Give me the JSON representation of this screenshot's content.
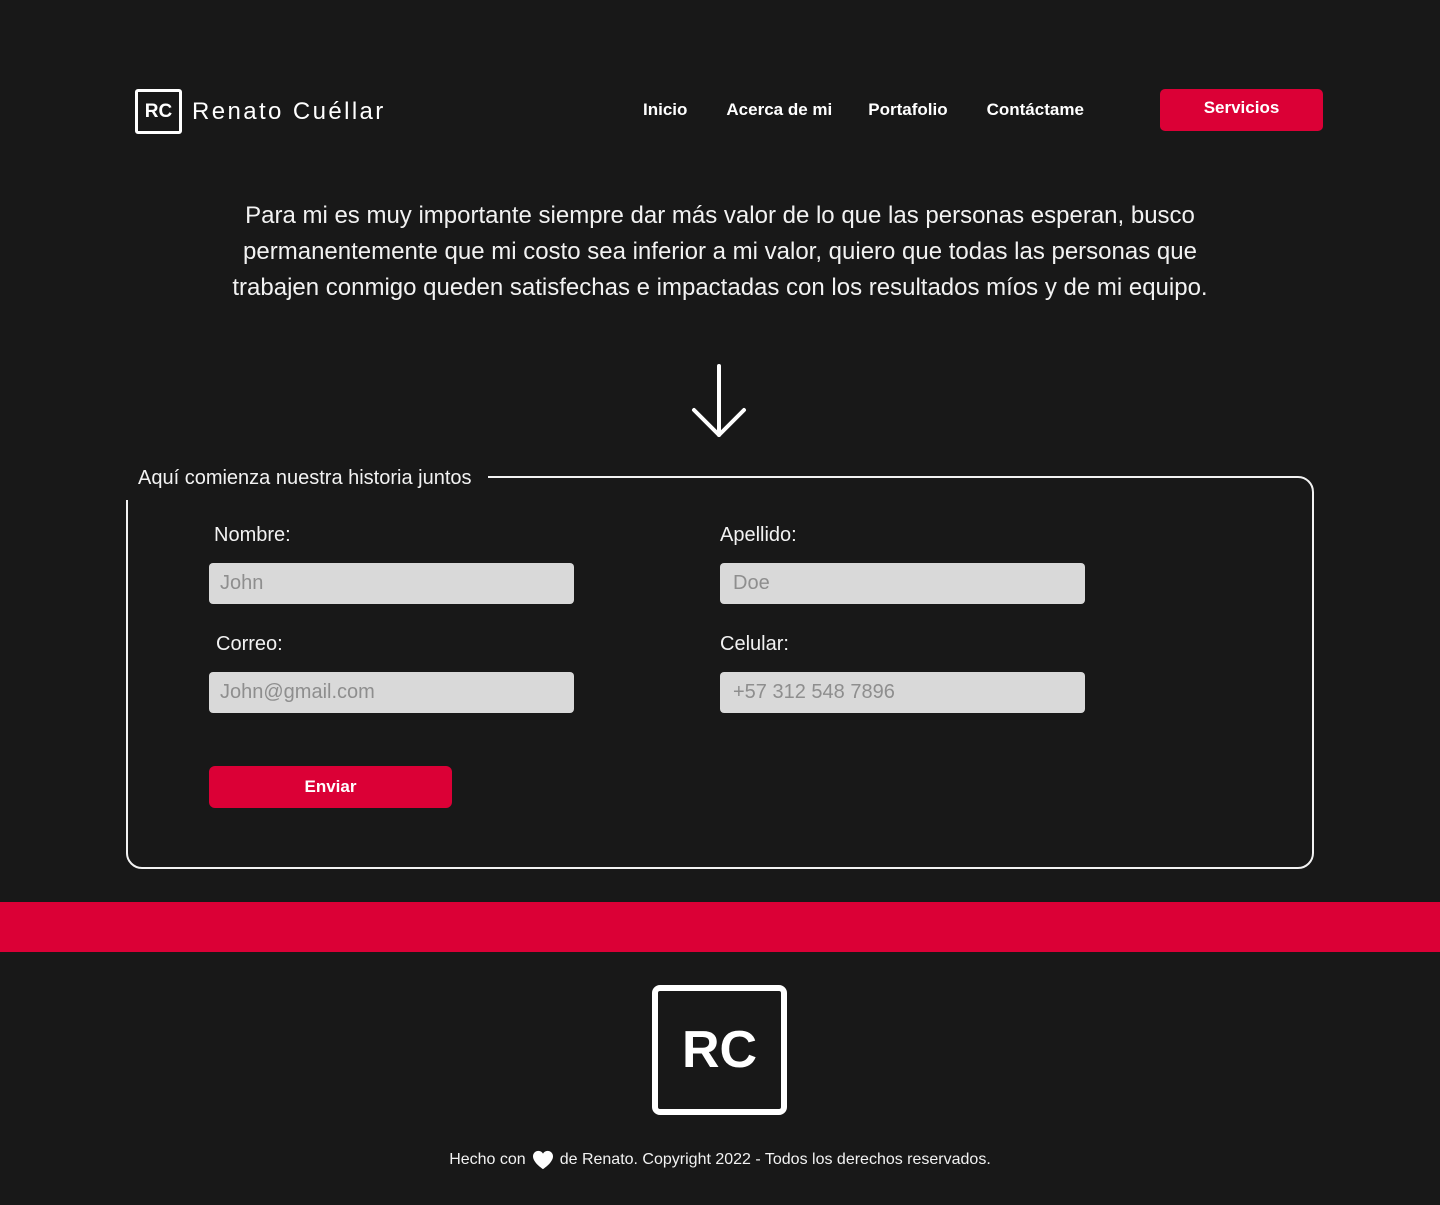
{
  "header": {
    "logo_initials": "RC",
    "logo_name": "Renato Cuéllar",
    "nav": [
      "Inicio",
      "Acerca de mi",
      "Portafolio",
      "Contáctame"
    ],
    "cta_label": "Servicios"
  },
  "intro": {
    "text": "Para mi es muy importante siempre dar más valor de lo que las personas esperan, busco permanentemente que mi costo sea inferior a mi valor, quiero que todas las personas que trabajen conmigo queden satisfechas e impactadas con los resultados míos y de mi equipo."
  },
  "form": {
    "legend": "Aquí comienza nuestra historia juntos",
    "fields": [
      {
        "label": "Nombre:",
        "placeholder": "John",
        "value": ""
      },
      {
        "label": "Apellido:",
        "placeholder": "Doe",
        "value": ""
      },
      {
        "label": "Correo:",
        "placeholder": "John@gmail.com",
        "value": ""
      },
      {
        "label": "Celular:",
        "placeholder": "+57 312 548 7896",
        "value": ""
      }
    ],
    "submit_label": "Enviar"
  },
  "footer": {
    "logo_initials": "RC",
    "text_before": "Hecho con",
    "text_after": "de Renato. Copyright 2022 - Todos los derechos reservados."
  },
  "colors": {
    "background": "#181818",
    "accent": "#db0036",
    "input_bg": "#d9d9d9"
  }
}
